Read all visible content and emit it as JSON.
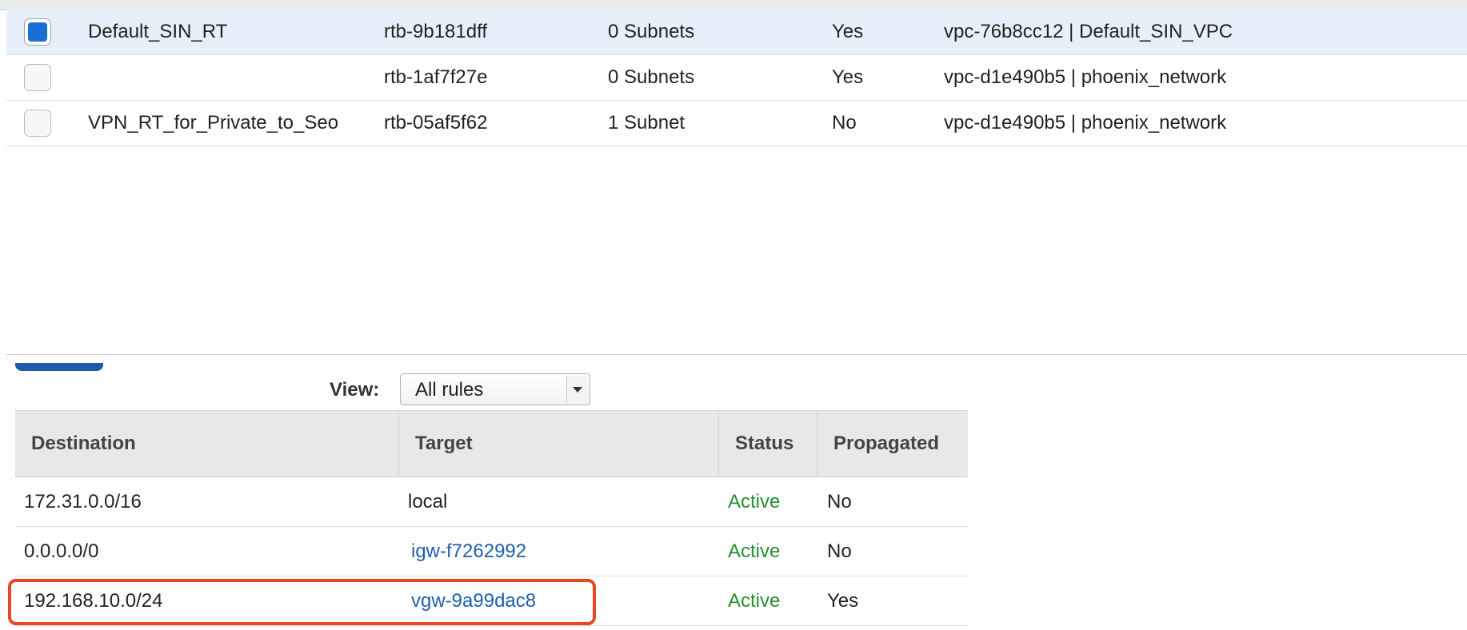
{
  "route_tables": [
    {
      "name": "Default_SIN_RT",
      "id": "rtb-9b181dff",
      "associations": "0 Subnets",
      "main": "Yes",
      "vpc": "vpc-76b8cc12 | Default_SIN_VPC",
      "selected": true
    },
    {
      "name": "",
      "id": "rtb-1af7f27e",
      "associations": "0 Subnets",
      "main": "Yes",
      "vpc": "vpc-d1e490b5 | phoenix_network",
      "selected": false
    },
    {
      "name": "VPN_RT_for_Private_to_Seo",
      "id": "rtb-05af5f62",
      "associations": "1 Subnet",
      "main": "No",
      "vpc": "vpc-d1e490b5 | phoenix_network",
      "selected": false
    }
  ],
  "routes_panel": {
    "view_label": "View:",
    "view_selected": "All rules",
    "headers": {
      "destination": "Destination",
      "target": "Target",
      "status": "Status",
      "propagated": "Propagated"
    },
    "rows": [
      {
        "destination": "172.31.0.0/16",
        "target": "local",
        "status": "Active",
        "propagated": "No"
      },
      {
        "destination": "0.0.0.0/0",
        "target": "igw-f7262992",
        "status": "Active",
        "propagated": "No"
      },
      {
        "destination": "192.168.10.0/24",
        "target": "vgw-9a99dac8",
        "status": "Active",
        "propagated": "Yes"
      }
    ]
  },
  "colors": {
    "selected_row": "#e7f0fa",
    "link": "#1f5fae",
    "status_active": "#24902f",
    "highlight": "#e8481f",
    "checkbox_checked": "#1a6fd6"
  }
}
